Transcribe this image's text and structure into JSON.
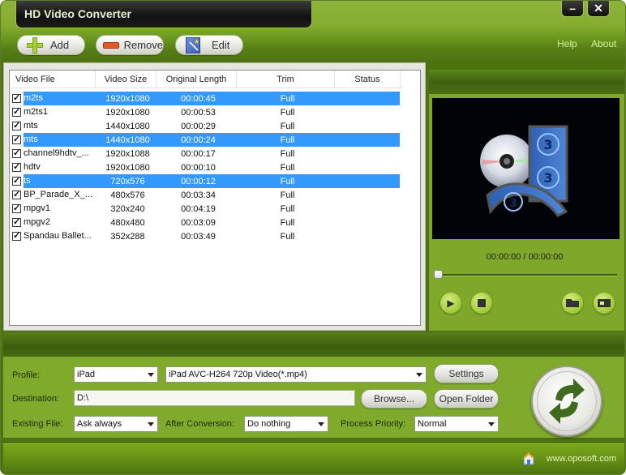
{
  "app": {
    "title": "HD Video Converter",
    "window_controls": {
      "minimize": "–",
      "close": "✕"
    }
  },
  "toolbar": {
    "add_label": "Add",
    "remove_label": "Remove",
    "edit_label": "Edit",
    "help_label": "Help",
    "about_label": "About"
  },
  "file_list": {
    "columns": [
      "Video File",
      "Video Size",
      "Original Length",
      "Trim",
      "Status"
    ],
    "rows": [
      {
        "checked": true,
        "selected": true,
        "file": "m2ts",
        "size": "1920x1080",
        "length": "00:00:45",
        "trim": "Full",
        "status": ""
      },
      {
        "checked": true,
        "selected": false,
        "file": "m2ts1",
        "size": "1920x1080",
        "length": "00:00:53",
        "trim": "Full",
        "status": ""
      },
      {
        "checked": true,
        "selected": false,
        "file": "mts",
        "size": "1440x1080",
        "length": "00:00:29",
        "trim": "Full",
        "status": ""
      },
      {
        "checked": true,
        "selected": true,
        "file": "mts",
        "size": "1440x1080",
        "length": "00:00:24",
        "trim": "Full",
        "status": ""
      },
      {
        "checked": true,
        "selected": false,
        "file": "channel9hdtv_...",
        "size": "1920x1088",
        "length": "00:00:17",
        "trim": "Full",
        "status": ""
      },
      {
        "checked": true,
        "selected": false,
        "file": "hdtv",
        "size": "1920x1080",
        "length": "00:00:10",
        "trim": "Full",
        "status": ""
      },
      {
        "checked": true,
        "selected": true,
        "file": "ts",
        "size": "720x576",
        "length": "00:00:12",
        "trim": "Full",
        "status": ""
      },
      {
        "checked": true,
        "selected": false,
        "file": "BP_Parade_X_...",
        "size": "480x576",
        "length": "00:03:34",
        "trim": "Full",
        "status": ""
      },
      {
        "checked": true,
        "selected": false,
        "file": "mpgv1",
        "size": "320x240",
        "length": "00:04:19",
        "trim": "Full",
        "status": ""
      },
      {
        "checked": true,
        "selected": false,
        "file": "mpgv2",
        "size": "480x480",
        "length": "00:03:09",
        "trim": "Full",
        "status": ""
      },
      {
        "checked": true,
        "selected": false,
        "file": "Spandau Ballet...",
        "size": "352x288",
        "length": "00:03:49",
        "trim": "Full",
        "status": ""
      }
    ]
  },
  "preview": {
    "time_readout": "00:00:00 / 00:00:00",
    "seek_progress": 0,
    "buttons": [
      "play",
      "stop",
      "open-folder",
      "snapshot"
    ]
  },
  "settings": {
    "profile_label": "Profile:",
    "profile_device": "iPad",
    "profile_format": "iPad AVC-H264 720p Video(*.mp4)",
    "settings_button": "Settings",
    "destination_label": "Destination:",
    "destination_value": "D:\\",
    "browse_button": "Browse...",
    "open_folder_button": "Open Folder",
    "existing_file_label": "Existing File:",
    "existing_file_value": "Ask always",
    "after_conversion_label": "After Conversion:",
    "after_conversion_value": "Do nothing",
    "priority_label": "Process Priority:",
    "priority_value": "Normal"
  },
  "footer": {
    "website": "www.oposoft.com"
  },
  "colors": {
    "brand_green": "#80aa2c",
    "dark_green": "#3d5c0d",
    "selection_blue": "#3399ff",
    "convert_arrow": "#3f6b1e"
  }
}
